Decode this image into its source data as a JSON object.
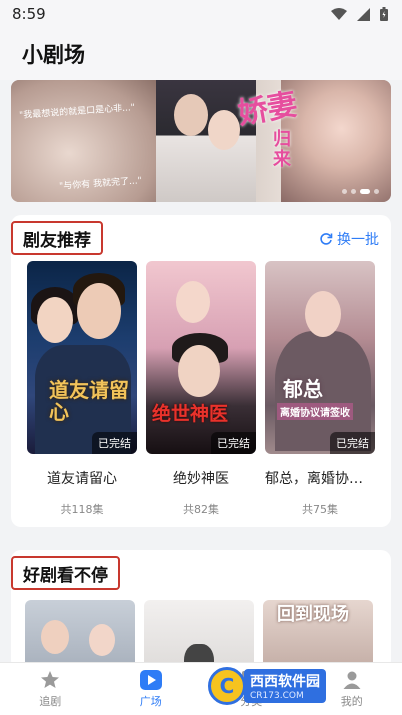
{
  "status_bar": {
    "time": "8:59",
    "icons": [
      "wifi-icon",
      "signal-icon",
      "battery-icon"
    ]
  },
  "header": {
    "title": "小剧场"
  },
  "banner": {
    "quote_top": "\"我最想说的就是口是心非...\"",
    "quote_bottom": "\"与你有 我就完了...\"",
    "title_main": "娇妻",
    "title_sub": "归来",
    "slide_count": 4,
    "active_slide": 3
  },
  "recommend": {
    "title": "剧友推荐",
    "refresh_label": "换一批",
    "items": [
      {
        "poster_text": "道友请留心",
        "badge": "已完结",
        "name": "道友请留心",
        "episodes": "共118集"
      },
      {
        "poster_text": "绝世神医",
        "badge": "已完结",
        "name": "绝妙神医",
        "episodes": "共82集"
      },
      {
        "poster_text": "郁总",
        "poster_subtext": "离婚协议请签收",
        "badge": "已完结",
        "name": "郁总，离婚协议...",
        "episodes": "共75集"
      }
    ]
  },
  "nonstop": {
    "title": "好剧看不停",
    "poster_text_3": "回到现场"
  },
  "tab_bar": {
    "tabs": [
      {
        "label": "追剧",
        "icon": "star-icon",
        "active": false
      },
      {
        "label": "广场",
        "icon": "play-icon",
        "active": true
      },
      {
        "label": "分类",
        "icon": "category-icon",
        "active": false
      },
      {
        "label": "我的",
        "icon": "profile-icon",
        "active": false
      }
    ]
  },
  "watermark": {
    "mark": "C",
    "main": "西西软件园",
    "sub": "CR173.COM"
  },
  "colors": {
    "accent": "#2e7cf6",
    "section_outline": "#c8382e",
    "banner_title": "#e64e9e",
    "background": "#f2f3f5"
  }
}
